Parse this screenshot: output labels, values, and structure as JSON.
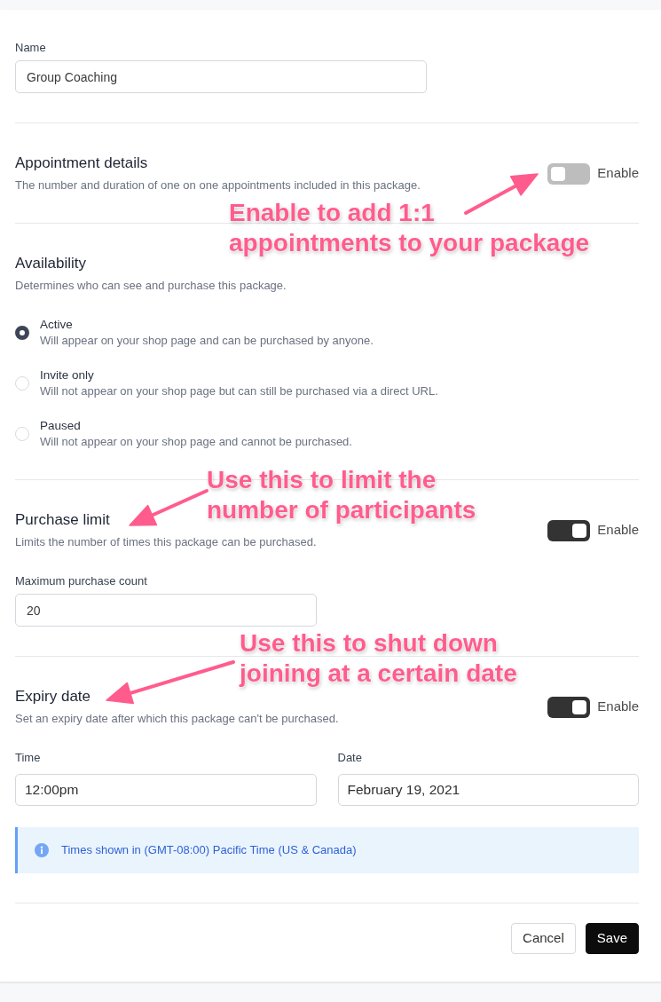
{
  "form": {
    "name_field": {
      "label": "Name",
      "value": "Group Coaching"
    },
    "sections": [
      {
        "kind": "switch",
        "title": "Appointment details",
        "description": "The number and duration of one on one appointments included in this package.",
        "toggle": {
          "label": "Enable",
          "on": false
        }
      },
      {
        "kind": "choice",
        "title": "Availability",
        "description": "Determines who can see and purchase this package.",
        "options": [
          {
            "label": "Active",
            "description": "Will appear on your shop page and can be purchased by anyone.",
            "selected": true
          },
          {
            "label": "Invite only",
            "description": "Will not appear on your shop page but can still be purchased via a direct URL.",
            "selected": false
          },
          {
            "label": "Paused",
            "description": "Will not appear on your shop page and cannot be purchased.",
            "selected": false
          }
        ]
      },
      {
        "kind": "switch",
        "title": "Purchase limit",
        "description": "Limits the number of times this package can be purchased.",
        "toggle": {
          "label": "Enable",
          "on": true
        },
        "fields": [
          {
            "kind": "number",
            "label": "Maximum purchase count",
            "value": "20"
          }
        ]
      },
      {
        "kind": "switch",
        "title": "Expiry date",
        "description": "Set an expiry date after which this package can't be purchased.",
        "toggle": {
          "label": "Enable",
          "on": true
        },
        "fields": [
          {
            "kind": "time",
            "label": "Time",
            "value": "12:00pm"
          },
          {
            "kind": "date",
            "label": "Date",
            "value": "February 19, 2021"
          }
        ],
        "notice": {
          "text": "Times shown in (GMT-08:00) Pacific Time (US & Canada)"
        }
      }
    ],
    "buttons": [
      {
        "kind": "secondary",
        "label": "Cancel"
      },
      {
        "kind": "primary",
        "label": "Save"
      }
    ]
  },
  "annotations": [
    {
      "text": "Enable to add 1:1\nappointments to your package"
    },
    {
      "text": "Use this to limit the\nnumber of participants"
    },
    {
      "text": "Use this to shut down\njoining at a certain date"
    }
  ]
}
